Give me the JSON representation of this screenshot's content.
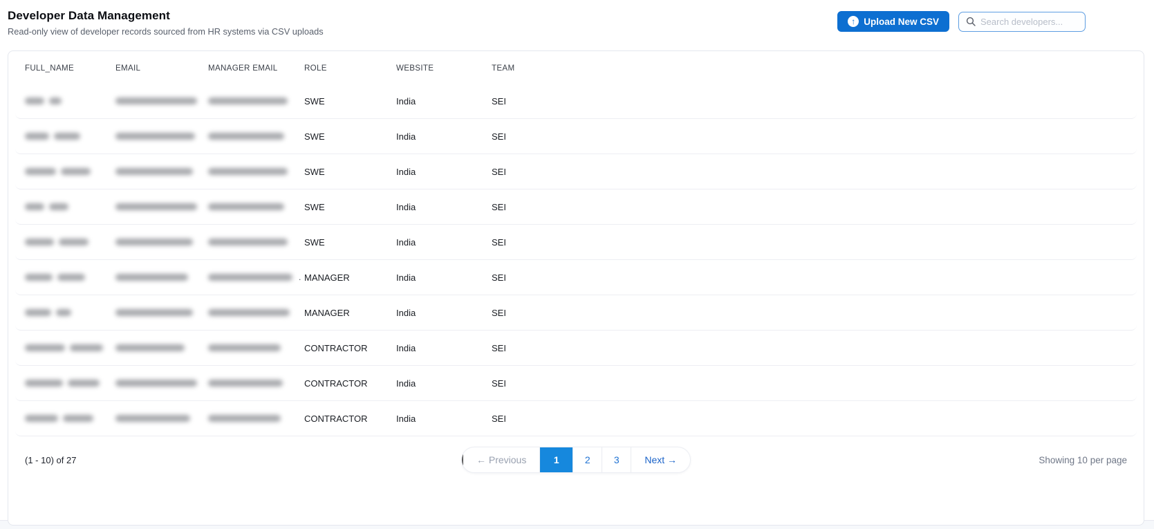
{
  "page": {
    "title": "Developer Data Management",
    "subtitle": "Read-only view of developer records sourced from HR systems via CSV uploads"
  },
  "toolbar": {
    "upload_label": "Upload New CSV",
    "upload_icon": "arrow-up-circle",
    "search_placeholder": "Search developers...",
    "search_icon": "magnifier"
  },
  "table": {
    "columns": [
      "FULL_NAME",
      "EMAIL",
      "MANAGER EMAIL",
      "ROLE",
      "WEBSITE",
      "TEAM"
    ],
    "redacted_columns": [
      "FULL_NAME",
      "EMAIL",
      "MANAGER EMAIL"
    ],
    "rows": [
      {
        "full_name_blur": [
          28,
          18
        ],
        "email_blur": [
          118
        ],
        "manager_email_blur": [
          115
        ],
        "manager_suffix": "",
        "role": "SWE",
        "website": "India",
        "team": "SEI"
      },
      {
        "full_name_blur": [
          35,
          38
        ],
        "email_blur": [
          115
        ],
        "manager_email_blur": [
          110
        ],
        "manager_suffix": "",
        "role": "SWE",
        "website": "India",
        "team": "SEI"
      },
      {
        "full_name_blur": [
          45,
          43
        ],
        "email_blur": [
          112
        ],
        "manager_email_blur": [
          115
        ],
        "manager_suffix": "",
        "role": "SWE",
        "website": "India",
        "team": "SEI"
      },
      {
        "full_name_blur": [
          28,
          28
        ],
        "email_blur": [
          118
        ],
        "manager_email_blur": [
          110
        ],
        "manager_suffix": "",
        "role": "SWE",
        "website": "India",
        "team": "SEI"
      },
      {
        "full_name_blur": [
          42,
          43
        ],
        "email_blur": [
          112
        ],
        "manager_email_blur": [
          115
        ],
        "manager_suffix": "",
        "role": "SWE",
        "website": "India",
        "team": "SEI"
      },
      {
        "full_name_blur": [
          40,
          40
        ],
        "email_blur": [
          105
        ],
        "manager_email_blur": [
          122
        ],
        "manager_suffix": ".",
        "role": "MANAGER",
        "website": "India",
        "team": "SEI"
      },
      {
        "full_name_blur": [
          38,
          22
        ],
        "email_blur": [
          112
        ],
        "manager_email_blur": [
          118
        ],
        "manager_suffix": "",
        "role": "MANAGER",
        "website": "India",
        "team": "SEI"
      },
      {
        "full_name_blur": [
          58,
          48
        ],
        "email_blur": [
          100
        ],
        "manager_email_blur": [
          105
        ],
        "manager_suffix": "",
        "role": "CONTRACTOR",
        "website": "India",
        "team": "SEI"
      },
      {
        "full_name_blur": [
          55,
          46
        ],
        "email_blur": [
          118
        ],
        "manager_email_blur": [
          108
        ],
        "manager_suffix": "",
        "role": "CONTRACTOR",
        "website": "India",
        "team": "SEI"
      },
      {
        "full_name_blur": [
          48,
          44
        ],
        "email_blur": [
          108
        ],
        "manager_email_blur": [
          105
        ],
        "manager_suffix": "",
        "role": "CONTRACTOR",
        "website": "India",
        "team": "SEI"
      }
    ]
  },
  "footer": {
    "range_label": "(1 - 10) of 27",
    "per_page_label": "Showing 10 per page",
    "pagination": {
      "previous_label": "← Previous",
      "pages": [
        "1",
        "2",
        "3"
      ],
      "active_page": "1",
      "next_label": "Next →"
    }
  },
  "colors": {
    "accent_blue": "#0d6fd1",
    "active_page_blue": "#1688dd",
    "link_blue": "#2173d3",
    "search_border_blue": "#5d9de2",
    "page_background": "#f6f8fb"
  }
}
